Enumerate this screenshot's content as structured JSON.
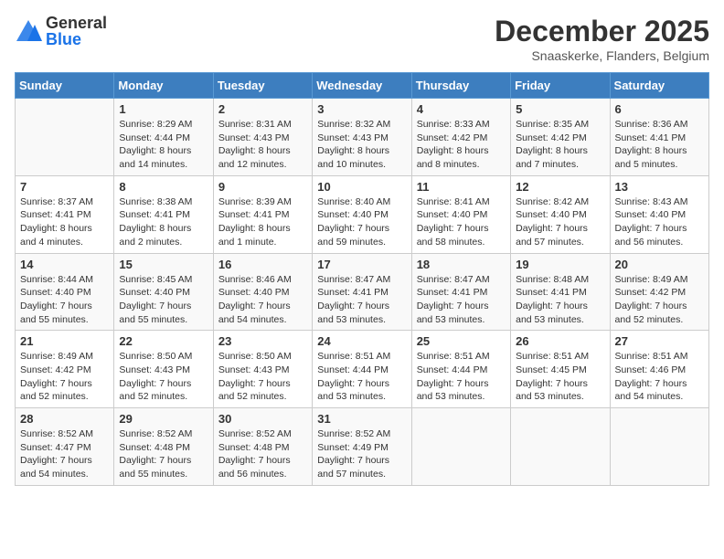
{
  "header": {
    "logo_general": "General",
    "logo_blue": "Blue",
    "month_title": "December 2025",
    "subtitle": "Snaaskerke, Flanders, Belgium"
  },
  "weekdays": [
    "Sunday",
    "Monday",
    "Tuesday",
    "Wednesday",
    "Thursday",
    "Friday",
    "Saturday"
  ],
  "weeks": [
    [
      {
        "day": "",
        "info": ""
      },
      {
        "day": "1",
        "info": "Sunrise: 8:29 AM\nSunset: 4:44 PM\nDaylight: 8 hours\nand 14 minutes."
      },
      {
        "day": "2",
        "info": "Sunrise: 8:31 AM\nSunset: 4:43 PM\nDaylight: 8 hours\nand 12 minutes."
      },
      {
        "day": "3",
        "info": "Sunrise: 8:32 AM\nSunset: 4:43 PM\nDaylight: 8 hours\nand 10 minutes."
      },
      {
        "day": "4",
        "info": "Sunrise: 8:33 AM\nSunset: 4:42 PM\nDaylight: 8 hours\nand 8 minutes."
      },
      {
        "day": "5",
        "info": "Sunrise: 8:35 AM\nSunset: 4:42 PM\nDaylight: 8 hours\nand 7 minutes."
      },
      {
        "day": "6",
        "info": "Sunrise: 8:36 AM\nSunset: 4:41 PM\nDaylight: 8 hours\nand 5 minutes."
      }
    ],
    [
      {
        "day": "7",
        "info": "Sunrise: 8:37 AM\nSunset: 4:41 PM\nDaylight: 8 hours\nand 4 minutes."
      },
      {
        "day": "8",
        "info": "Sunrise: 8:38 AM\nSunset: 4:41 PM\nDaylight: 8 hours\nand 2 minutes."
      },
      {
        "day": "9",
        "info": "Sunrise: 8:39 AM\nSunset: 4:41 PM\nDaylight: 8 hours\nand 1 minute."
      },
      {
        "day": "10",
        "info": "Sunrise: 8:40 AM\nSunset: 4:40 PM\nDaylight: 7 hours\nand 59 minutes."
      },
      {
        "day": "11",
        "info": "Sunrise: 8:41 AM\nSunset: 4:40 PM\nDaylight: 7 hours\nand 58 minutes."
      },
      {
        "day": "12",
        "info": "Sunrise: 8:42 AM\nSunset: 4:40 PM\nDaylight: 7 hours\nand 57 minutes."
      },
      {
        "day": "13",
        "info": "Sunrise: 8:43 AM\nSunset: 4:40 PM\nDaylight: 7 hours\nand 56 minutes."
      }
    ],
    [
      {
        "day": "14",
        "info": "Sunrise: 8:44 AM\nSunset: 4:40 PM\nDaylight: 7 hours\nand 55 minutes."
      },
      {
        "day": "15",
        "info": "Sunrise: 8:45 AM\nSunset: 4:40 PM\nDaylight: 7 hours\nand 55 minutes."
      },
      {
        "day": "16",
        "info": "Sunrise: 8:46 AM\nSunset: 4:40 PM\nDaylight: 7 hours\nand 54 minutes."
      },
      {
        "day": "17",
        "info": "Sunrise: 8:47 AM\nSunset: 4:41 PM\nDaylight: 7 hours\nand 53 minutes."
      },
      {
        "day": "18",
        "info": "Sunrise: 8:47 AM\nSunset: 4:41 PM\nDaylight: 7 hours\nand 53 minutes."
      },
      {
        "day": "19",
        "info": "Sunrise: 8:48 AM\nSunset: 4:41 PM\nDaylight: 7 hours\nand 53 minutes."
      },
      {
        "day": "20",
        "info": "Sunrise: 8:49 AM\nSunset: 4:42 PM\nDaylight: 7 hours\nand 52 minutes."
      }
    ],
    [
      {
        "day": "21",
        "info": "Sunrise: 8:49 AM\nSunset: 4:42 PM\nDaylight: 7 hours\nand 52 minutes."
      },
      {
        "day": "22",
        "info": "Sunrise: 8:50 AM\nSunset: 4:43 PM\nDaylight: 7 hours\nand 52 minutes."
      },
      {
        "day": "23",
        "info": "Sunrise: 8:50 AM\nSunset: 4:43 PM\nDaylight: 7 hours\nand 52 minutes."
      },
      {
        "day": "24",
        "info": "Sunrise: 8:51 AM\nSunset: 4:44 PM\nDaylight: 7 hours\nand 53 minutes."
      },
      {
        "day": "25",
        "info": "Sunrise: 8:51 AM\nSunset: 4:44 PM\nDaylight: 7 hours\nand 53 minutes."
      },
      {
        "day": "26",
        "info": "Sunrise: 8:51 AM\nSunset: 4:45 PM\nDaylight: 7 hours\nand 53 minutes."
      },
      {
        "day": "27",
        "info": "Sunrise: 8:51 AM\nSunset: 4:46 PM\nDaylight: 7 hours\nand 54 minutes."
      }
    ],
    [
      {
        "day": "28",
        "info": "Sunrise: 8:52 AM\nSunset: 4:47 PM\nDaylight: 7 hours\nand 54 minutes."
      },
      {
        "day": "29",
        "info": "Sunrise: 8:52 AM\nSunset: 4:48 PM\nDaylight: 7 hours\nand 55 minutes."
      },
      {
        "day": "30",
        "info": "Sunrise: 8:52 AM\nSunset: 4:48 PM\nDaylight: 7 hours\nand 56 minutes."
      },
      {
        "day": "31",
        "info": "Sunrise: 8:52 AM\nSunset: 4:49 PM\nDaylight: 7 hours\nand 57 minutes."
      },
      {
        "day": "",
        "info": ""
      },
      {
        "day": "",
        "info": ""
      },
      {
        "day": "",
        "info": ""
      }
    ]
  ]
}
